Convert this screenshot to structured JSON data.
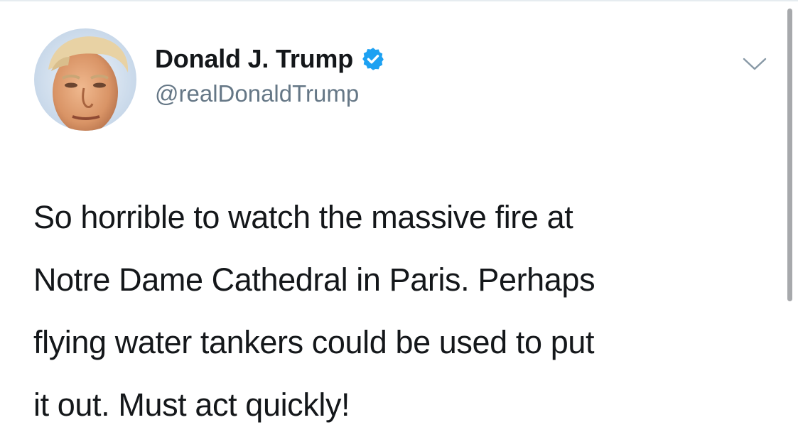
{
  "tweet": {
    "author": {
      "name": "Donald J. Trump",
      "handle": "@realDonaldTrump",
      "verified": true,
      "avatar_icon": "profile-photo"
    },
    "menu_icon": "chevron-down-icon",
    "text_lines": [
      "So horrible to watch the massive fire at",
      "Notre Dame Cathedral in Paris. Perhaps",
      "flying water tankers could be used to put",
      "it out. Must act quickly!"
    ]
  },
  "colors": {
    "text": "#14171a",
    "secondary_text": "#657786",
    "verified_blue": "#1da1f2",
    "scrollbar": "#a7a9ac",
    "divider": "#e6ecf0"
  }
}
